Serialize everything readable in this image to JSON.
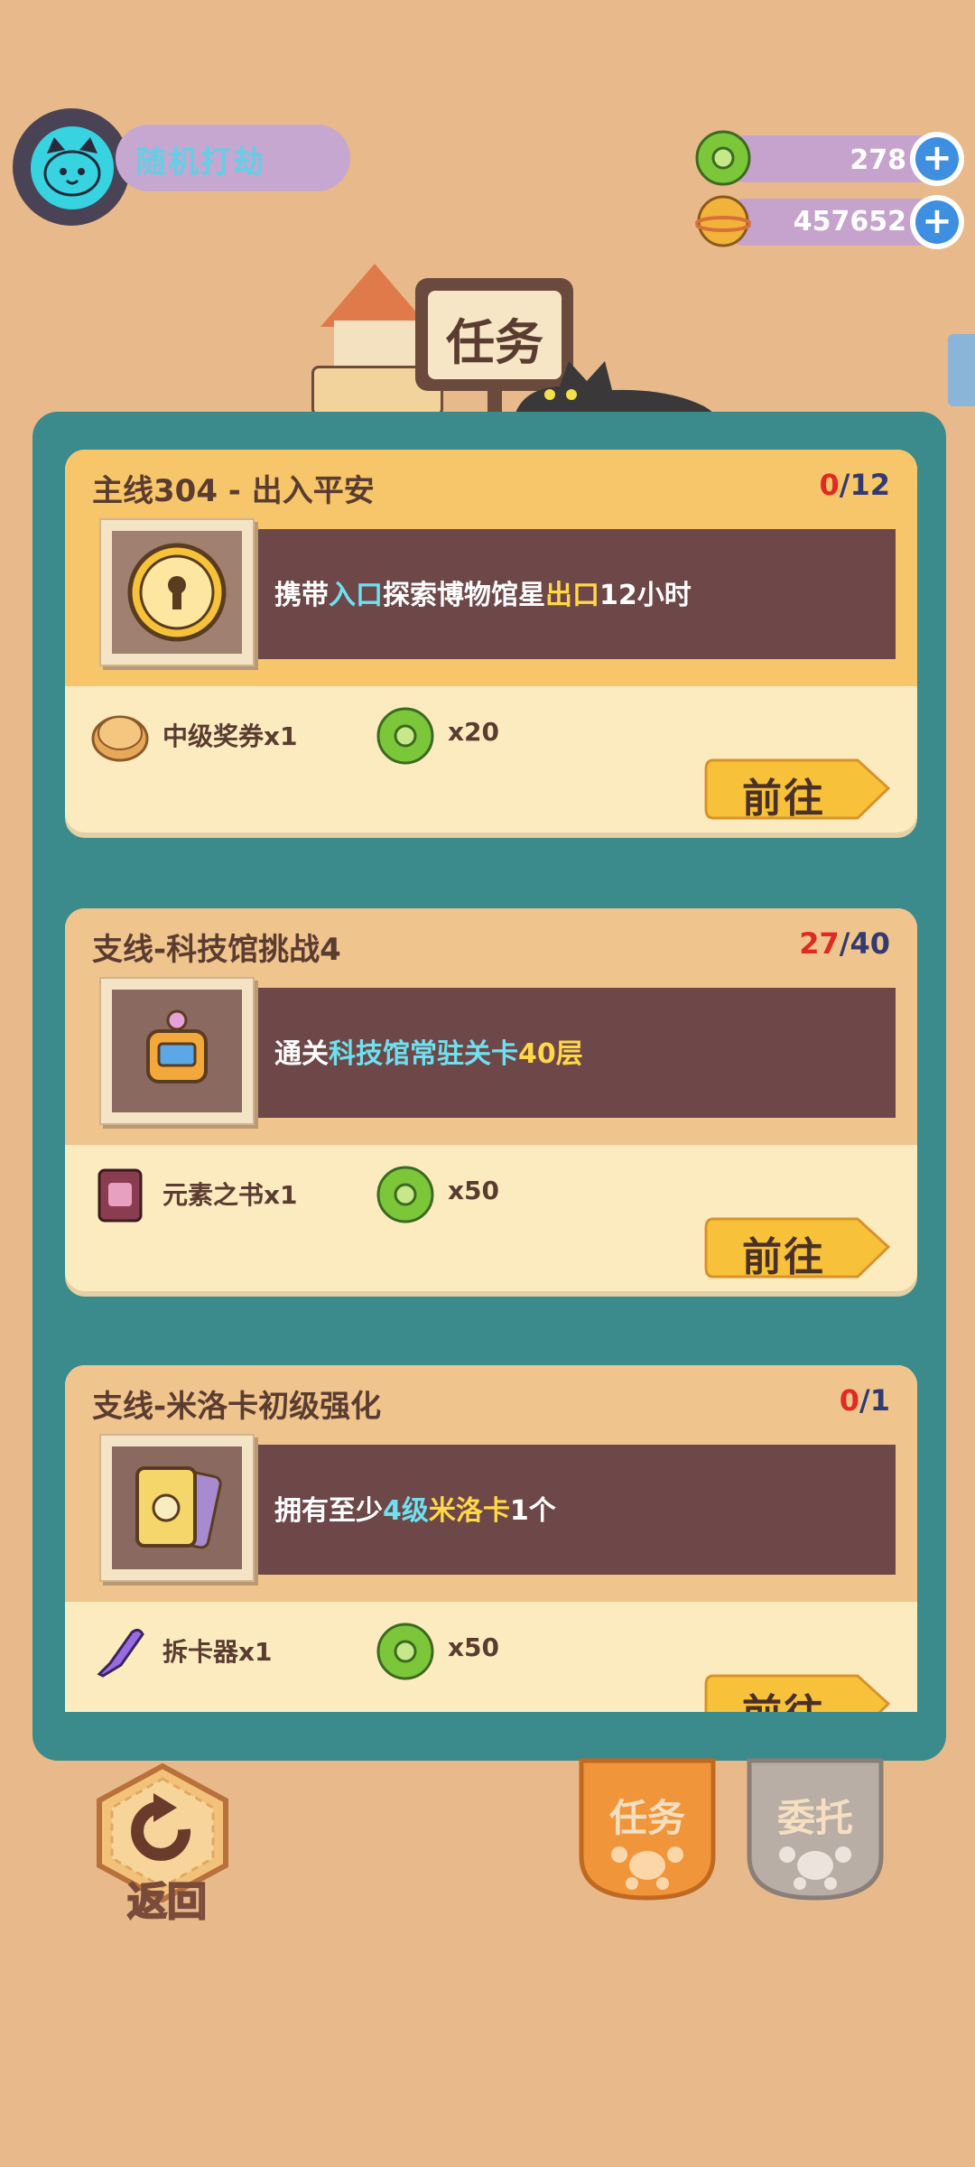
{
  "header": {
    "mode_label": "随机打劫",
    "screen_title": "任务"
  },
  "currency": [
    {
      "name": "green-donut",
      "value": "278",
      "color": "#7cc63a"
    },
    {
      "name": "gold-planet",
      "value": "457652",
      "color": "#f2b33a"
    }
  ],
  "tasks": [
    {
      "title": "主线304 - 出入平安",
      "progress_current": "0",
      "progress_sep": "/",
      "progress_total": "12",
      "desc_parts": [
        "携带",
        "入口",
        "探索博物馆星",
        "出口",
        "12小时"
      ],
      "rewards": [
        {
          "label": "中级奖券x1"
        },
        {
          "label": "x20"
        }
      ],
      "go_label": "前往"
    },
    {
      "title": "支线-科技馆挑战4",
      "progress_current": "27",
      "progress_sep": "/",
      "progress_total": "40",
      "desc_parts": [
        "通关",
        "科技馆常驻关卡",
        "40层"
      ],
      "rewards": [
        {
          "label": "元素之书x1"
        },
        {
          "label": "x50"
        }
      ],
      "go_label": "前往"
    },
    {
      "title": "支线-米洛卡初级强化",
      "progress_current": "0",
      "progress_sep": "/",
      "progress_total": "1",
      "desc_parts": [
        "拥有至少",
        "4级",
        "米洛卡",
        "1个"
      ],
      "rewards": [
        {
          "label": "拆卡器x1"
        },
        {
          "label": "x50"
        }
      ],
      "go_label": "前往"
    }
  ],
  "bottom": {
    "back_label": "返回",
    "tab_task": "任务",
    "tab_entrust": "委托"
  },
  "colors": {
    "background": "#e8b98a",
    "panel": "#3b8a8c",
    "card": "#fdebc0",
    "desc_bar": "#6e4748",
    "go_button": "#f7c23a"
  }
}
